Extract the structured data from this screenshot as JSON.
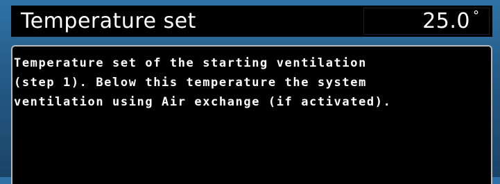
{
  "header": {
    "title": "Temperature set",
    "value": "25.0",
    "unit_symbol": "°"
  },
  "help": {
    "lines": [
      "Temperature set of the starting ventilation",
      "(step 1). Below this temperature the system",
      "ventilation using Air exchange (if activated)."
    ]
  }
}
